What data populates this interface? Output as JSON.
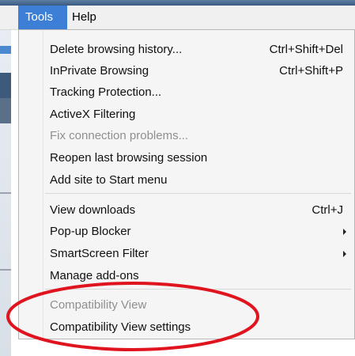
{
  "menubar": {
    "tools_label": "Tools",
    "help_label": "Help"
  },
  "menu": {
    "items": [
      {
        "label": "Delete browsing history...",
        "shortcut": "Ctrl+Shift+Del",
        "enabled": true
      },
      {
        "label": "InPrivate Browsing",
        "shortcut": "Ctrl+Shift+P",
        "enabled": true
      },
      {
        "label": "Tracking Protection...",
        "shortcut": "",
        "enabled": true
      },
      {
        "label": "ActiveX Filtering",
        "shortcut": "",
        "enabled": true
      },
      {
        "label": "Fix connection problems...",
        "shortcut": "",
        "enabled": false
      },
      {
        "label": "Reopen last browsing session",
        "shortcut": "",
        "enabled": true
      },
      {
        "label": "Add site to Start menu",
        "shortcut": "",
        "enabled": true
      },
      {
        "label": "View downloads",
        "shortcut": "Ctrl+J",
        "enabled": true
      },
      {
        "label": "Pop-up Blocker",
        "shortcut": "",
        "enabled": true,
        "submenu": true
      },
      {
        "label": "SmartScreen Filter",
        "shortcut": "",
        "enabled": true,
        "submenu": true
      },
      {
        "label": "Manage add-ons",
        "shortcut": "",
        "enabled": true
      },
      {
        "label": "Compatibility View",
        "shortcut": "",
        "enabled": false
      },
      {
        "label": "Compatibility View settings",
        "shortcut": "",
        "enabled": true
      }
    ]
  },
  "annotation": {
    "color": "#e0141e"
  },
  "colors": {
    "highlight": "#3d7fd6",
    "menu_bg": "#f5f5f5",
    "disabled_text": "#8f8f8f"
  }
}
